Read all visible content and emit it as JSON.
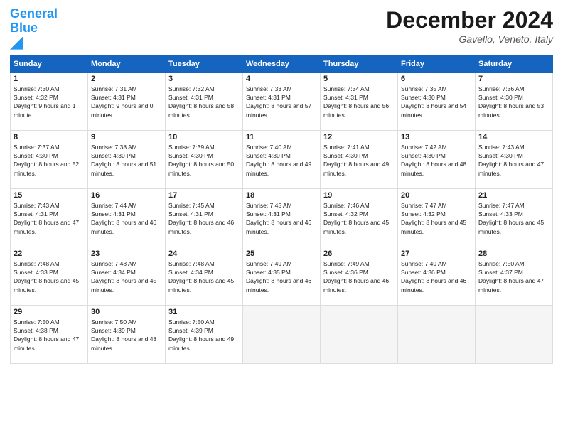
{
  "header": {
    "logo_general": "General",
    "logo_blue": "Blue",
    "title": "December 2024",
    "location": "Gavello, Veneto, Italy"
  },
  "days_of_week": [
    "Sunday",
    "Monday",
    "Tuesday",
    "Wednesday",
    "Thursday",
    "Friday",
    "Saturday"
  ],
  "weeks": [
    [
      {
        "day": 1,
        "sunrise": "7:30 AM",
        "sunset": "4:32 PM",
        "daylight": "9 hours and 1 minute."
      },
      {
        "day": 2,
        "sunrise": "7:31 AM",
        "sunset": "4:31 PM",
        "daylight": "9 hours and 0 minutes."
      },
      {
        "day": 3,
        "sunrise": "7:32 AM",
        "sunset": "4:31 PM",
        "daylight": "8 hours and 58 minutes."
      },
      {
        "day": 4,
        "sunrise": "7:33 AM",
        "sunset": "4:31 PM",
        "daylight": "8 hours and 57 minutes."
      },
      {
        "day": 5,
        "sunrise": "7:34 AM",
        "sunset": "4:31 PM",
        "daylight": "8 hours and 56 minutes."
      },
      {
        "day": 6,
        "sunrise": "7:35 AM",
        "sunset": "4:30 PM",
        "daylight": "8 hours and 54 minutes."
      },
      {
        "day": 7,
        "sunrise": "7:36 AM",
        "sunset": "4:30 PM",
        "daylight": "8 hours and 53 minutes."
      }
    ],
    [
      {
        "day": 8,
        "sunrise": "7:37 AM",
        "sunset": "4:30 PM",
        "daylight": "8 hours and 52 minutes."
      },
      {
        "day": 9,
        "sunrise": "7:38 AM",
        "sunset": "4:30 PM",
        "daylight": "8 hours and 51 minutes."
      },
      {
        "day": 10,
        "sunrise": "7:39 AM",
        "sunset": "4:30 PM",
        "daylight": "8 hours and 50 minutes."
      },
      {
        "day": 11,
        "sunrise": "7:40 AM",
        "sunset": "4:30 PM",
        "daylight": "8 hours and 49 minutes."
      },
      {
        "day": 12,
        "sunrise": "7:41 AM",
        "sunset": "4:30 PM",
        "daylight": "8 hours and 49 minutes."
      },
      {
        "day": 13,
        "sunrise": "7:42 AM",
        "sunset": "4:30 PM",
        "daylight": "8 hours and 48 minutes."
      },
      {
        "day": 14,
        "sunrise": "7:43 AM",
        "sunset": "4:30 PM",
        "daylight": "8 hours and 47 minutes."
      }
    ],
    [
      {
        "day": 15,
        "sunrise": "7:43 AM",
        "sunset": "4:31 PM",
        "daylight": "8 hours and 47 minutes."
      },
      {
        "day": 16,
        "sunrise": "7:44 AM",
        "sunset": "4:31 PM",
        "daylight": "8 hours and 46 minutes."
      },
      {
        "day": 17,
        "sunrise": "7:45 AM",
        "sunset": "4:31 PM",
        "daylight": "8 hours and 46 minutes."
      },
      {
        "day": 18,
        "sunrise": "7:45 AM",
        "sunset": "4:31 PM",
        "daylight": "8 hours and 46 minutes."
      },
      {
        "day": 19,
        "sunrise": "7:46 AM",
        "sunset": "4:32 PM",
        "daylight": "8 hours and 45 minutes."
      },
      {
        "day": 20,
        "sunrise": "7:47 AM",
        "sunset": "4:32 PM",
        "daylight": "8 hours and 45 minutes."
      },
      {
        "day": 21,
        "sunrise": "7:47 AM",
        "sunset": "4:33 PM",
        "daylight": "8 hours and 45 minutes."
      }
    ],
    [
      {
        "day": 22,
        "sunrise": "7:48 AM",
        "sunset": "4:33 PM",
        "daylight": "8 hours and 45 minutes."
      },
      {
        "day": 23,
        "sunrise": "7:48 AM",
        "sunset": "4:34 PM",
        "daylight": "8 hours and 45 minutes."
      },
      {
        "day": 24,
        "sunrise": "7:48 AM",
        "sunset": "4:34 PM",
        "daylight": "8 hours and 45 minutes."
      },
      {
        "day": 25,
        "sunrise": "7:49 AM",
        "sunset": "4:35 PM",
        "daylight": "8 hours and 46 minutes."
      },
      {
        "day": 26,
        "sunrise": "7:49 AM",
        "sunset": "4:36 PM",
        "daylight": "8 hours and 46 minutes."
      },
      {
        "day": 27,
        "sunrise": "7:49 AM",
        "sunset": "4:36 PM",
        "daylight": "8 hours and 46 minutes."
      },
      {
        "day": 28,
        "sunrise": "7:50 AM",
        "sunset": "4:37 PM",
        "daylight": "8 hours and 47 minutes."
      }
    ],
    [
      {
        "day": 29,
        "sunrise": "7:50 AM",
        "sunset": "4:38 PM",
        "daylight": "8 hours and 47 minutes."
      },
      {
        "day": 30,
        "sunrise": "7:50 AM",
        "sunset": "4:39 PM",
        "daylight": "8 hours and 48 minutes."
      },
      {
        "day": 31,
        "sunrise": "7:50 AM",
        "sunset": "4:39 PM",
        "daylight": "8 hours and 49 minutes."
      },
      null,
      null,
      null,
      null
    ]
  ]
}
